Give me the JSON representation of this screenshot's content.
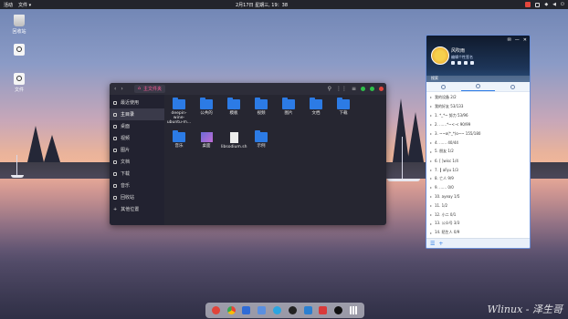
{
  "topbar": {
    "activities": "活动",
    "app_menu": "文件 ▾",
    "clock": "2月17日 星期三, 19：38"
  },
  "desktop": {
    "icons": [
      {
        "label": "回收站",
        "icon": "trash-icon"
      },
      {
        "label": "",
        "icon": "disc-icon"
      },
      {
        "label": "文件",
        "icon": "disc-icon"
      }
    ]
  },
  "file_manager": {
    "back": "‹",
    "forward": "›",
    "crumb": "主文件夹",
    "sidebar": [
      "最近使用",
      "主目录",
      "桌面",
      "视频",
      "图片",
      "文档",
      "下载",
      "音乐",
      "回收站",
      "其他位置"
    ],
    "items": [
      {
        "label": "deepin-wine-ubuntu-m...",
        "type": "folder"
      },
      {
        "label": "公共的",
        "type": "folder"
      },
      {
        "label": "模板",
        "type": "folder"
      },
      {
        "label": "视频",
        "type": "folder"
      },
      {
        "label": "图片",
        "type": "folder"
      },
      {
        "label": "文档",
        "type": "folder"
      },
      {
        "label": "下载",
        "type": "folder"
      },
      {
        "label": "音乐",
        "type": "folder"
      },
      {
        "label": "桌面",
        "type": "image"
      },
      {
        "label": "libsodium.sh",
        "type": "doc"
      },
      {
        "label": "示例",
        "type": "folder"
      }
    ]
  },
  "qq": {
    "name": "风吹雨",
    "signature": "编辑个性签名",
    "search": "搜索",
    "controls": [
      "✉",
      "—",
      "✕"
    ],
    "groups": [
      "我的设备 2/2",
      "我的好友 53/133",
      "1. *_*~ 努力  53/96",
      "2. ……*~<·<  90/99",
      "3. ~~o(*_*)o~~  155/180",
      "4. ……  40/44",
      "5. 朋友  1/2",
      "6. [ ]wisc 1/4",
      "7. ┃ aFyu 1/3",
      "8. 亡人  9/9",
      "9. …… 0/0",
      "10. ayeay 1/5",
      "11. 1/2",
      "12. 小二 0/1",
      "13. 公众号 3/3",
      "14. 陌生人 0/9",
      "15. 黑名单 0/0"
    ]
  },
  "watermark": "Wlinux - 泽生哥",
  "colors": {
    "accent": "#2c7be5",
    "pink": "#ff5b9a"
  }
}
